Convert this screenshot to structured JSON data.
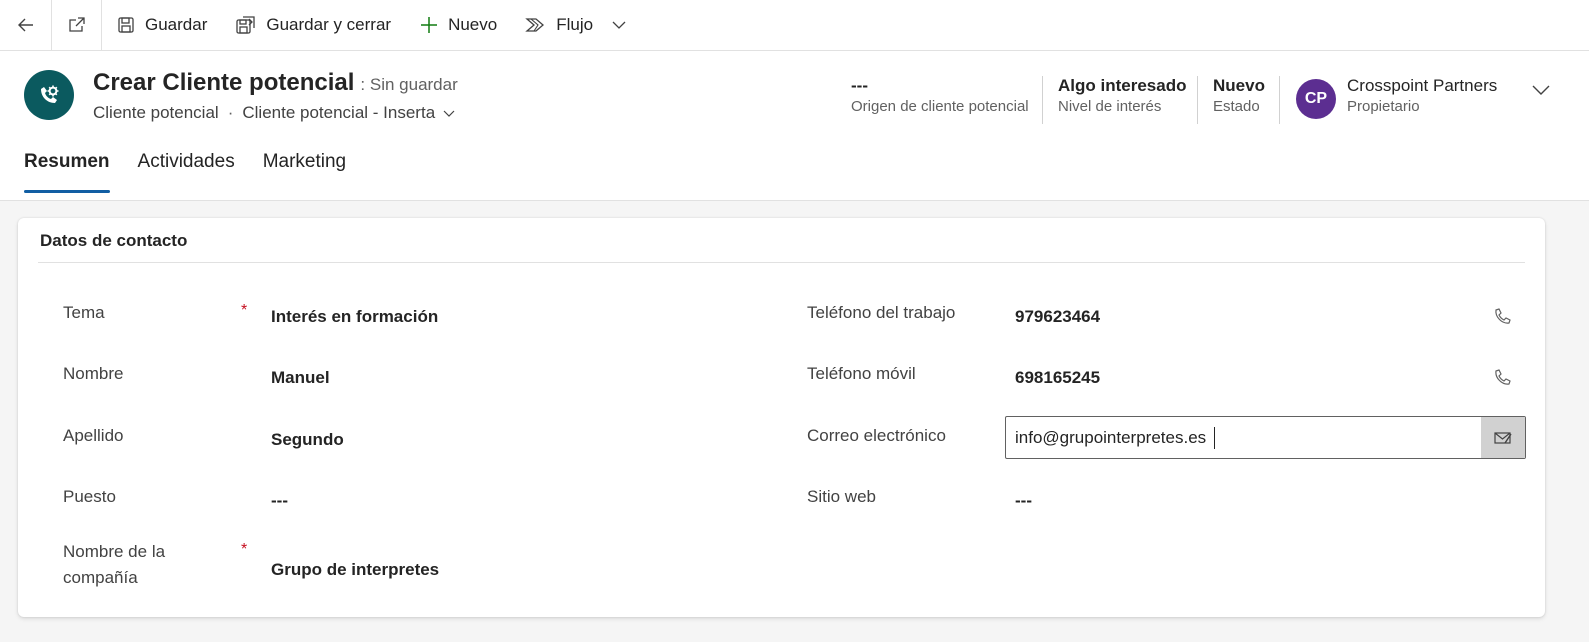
{
  "command_bar": {
    "back_icon": "arrow-left-icon",
    "popout_icon": "open-in-new-window-icon",
    "save": {
      "label": "Guardar",
      "icon": "save-icon"
    },
    "save_close": {
      "label": "Guardar y cerrar",
      "icon": "save-and-close-icon"
    },
    "new": {
      "label": "Nuevo",
      "icon": "plus-icon",
      "color": "#107c10"
    },
    "flow": {
      "label": "Flujo",
      "icon": "flow-icon"
    },
    "more_icon": "chevron-down-icon"
  },
  "header": {
    "entity_icon": "lead-icon",
    "entity_color": "#0b5a5f",
    "title": "Crear Cliente potencial",
    "status_suffix": ": Sin guardar",
    "entity_name": "Cliente potencial",
    "separator": "·",
    "form_name": "Cliente potencial - Inserta",
    "fields": [
      {
        "value": "---",
        "label": "Origen de cliente potencial"
      },
      {
        "value": "Algo interesado",
        "label": "Nivel de interés"
      },
      {
        "value": "Nuevo",
        "label": "Estado"
      }
    ],
    "owner": {
      "initials": "CP",
      "name": "Crosspoint Partners",
      "label": "Propietario",
      "avatar_color": "#5c2e91"
    }
  },
  "tabs": [
    {
      "label": "Resumen",
      "active": true
    },
    {
      "label": "Actividades",
      "active": false
    },
    {
      "label": "Marketing",
      "active": false
    }
  ],
  "section": {
    "title": "Datos de contacto",
    "left_fields": [
      {
        "label": "Tema",
        "required": true,
        "value": "Interés en formación"
      },
      {
        "label": "Nombre",
        "required": false,
        "value": "Manuel"
      },
      {
        "label": "Apellido",
        "required": false,
        "value": "Segundo"
      },
      {
        "label": "Puesto",
        "required": false,
        "value": "---"
      },
      {
        "label_line1": "Nombre de la",
        "label_line2": "compañía",
        "required": true,
        "value": "Grupo de interpretes"
      }
    ],
    "right_fields": [
      {
        "label": "Teléfono del trabajo",
        "value": "979623464",
        "action_icon": "phone-icon"
      },
      {
        "label": "Teléfono móvil",
        "value": "698165245",
        "action_icon": "phone-icon"
      },
      {
        "label": "Correo electrónico",
        "value": "info@grupointerpretes.es",
        "action_icon": "send-email-icon"
      },
      {
        "label": "Sitio web",
        "value": "---"
      }
    ],
    "required_mark": "*"
  }
}
